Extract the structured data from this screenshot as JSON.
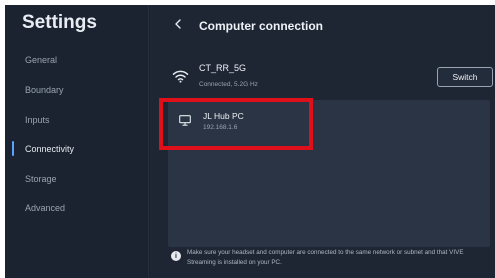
{
  "sidebar": {
    "title": "Settings",
    "items": [
      {
        "label": "General",
        "active": false
      },
      {
        "label": "Boundary",
        "active": false
      },
      {
        "label": "Inputs",
        "active": false
      },
      {
        "label": "Connectivity",
        "active": true
      },
      {
        "label": "Storage",
        "active": false
      },
      {
        "label": "Advanced",
        "active": false
      }
    ]
  },
  "header": {
    "back_icon": "chevron-left",
    "title": "Computer connection"
  },
  "network": {
    "icon": "wifi-icon",
    "name": "CT_RR_5G",
    "status": "Connected, 5.2G Hz",
    "switch_label": "Switch"
  },
  "computers": [
    {
      "icon": "monitor-icon",
      "name": "JL Hub PC",
      "ip": "192.168.1.6"
    }
  ],
  "note": {
    "icon": "info-icon",
    "text": "Make sure your headset and computer are connected to the same network or subnet and that VIVE Streaming is installed on your PC."
  },
  "colors": {
    "background": "#1e2634",
    "sidebar": "#1b2331",
    "panel": "#2b3444",
    "accent": "#5aa2ff",
    "highlight": "#e0101a"
  }
}
